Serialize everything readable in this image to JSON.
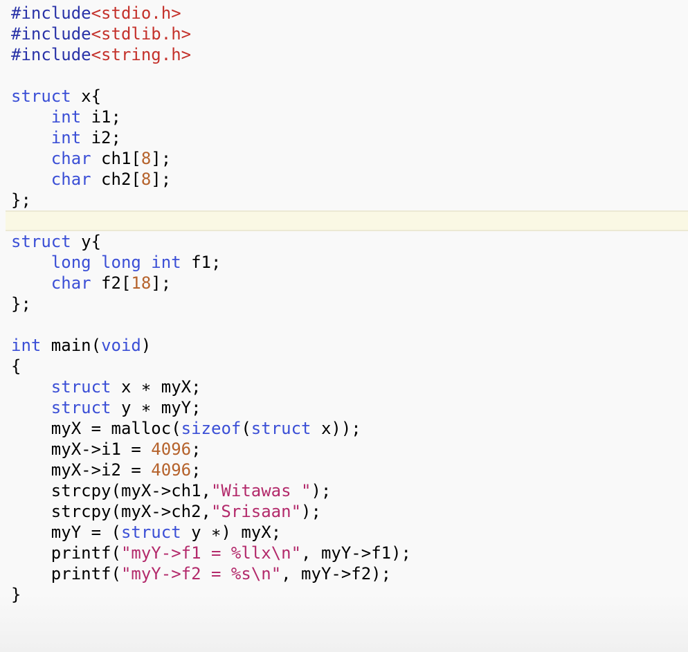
{
  "editor": {
    "language": "c",
    "current_line_index": 10,
    "colors": {
      "background": "#f9f9f9",
      "keyword": "#3b4fd6",
      "preprocessor": "#2a33a8",
      "include_path": "#c4312b",
      "number": "#b5622b",
      "string": "#b32a6b",
      "plain": "#000000",
      "current_line": "#faf8e4"
    },
    "lines": [
      [
        {
          "t": "pp",
          "v": "#include"
        },
        {
          "t": "inc",
          "v": "<stdio.h>"
        }
      ],
      [
        {
          "t": "pp",
          "v": "#include"
        },
        {
          "t": "inc",
          "v": "<stdlib.h>"
        }
      ],
      [
        {
          "t": "pp",
          "v": "#include"
        },
        {
          "t": "inc",
          "v": "<string.h>"
        }
      ],
      [],
      [
        {
          "t": "kw",
          "v": "struct"
        },
        {
          "t": "pl",
          "v": " x{"
        }
      ],
      [
        {
          "t": "pl",
          "v": "    "
        },
        {
          "t": "kw",
          "v": "int"
        },
        {
          "t": "pl",
          "v": " i1;"
        }
      ],
      [
        {
          "t": "pl",
          "v": "    "
        },
        {
          "t": "kw",
          "v": "int"
        },
        {
          "t": "pl",
          "v": " i2;"
        }
      ],
      [
        {
          "t": "pl",
          "v": "    "
        },
        {
          "t": "kw",
          "v": "char"
        },
        {
          "t": "pl",
          "v": " ch1["
        },
        {
          "t": "num",
          "v": "8"
        },
        {
          "t": "pl",
          "v": "];"
        }
      ],
      [
        {
          "t": "pl",
          "v": "    "
        },
        {
          "t": "kw",
          "v": "char"
        },
        {
          "t": "pl",
          "v": " ch2["
        },
        {
          "t": "num",
          "v": "8"
        },
        {
          "t": "pl",
          "v": "];"
        }
      ],
      [
        {
          "t": "pl",
          "v": "};"
        }
      ],
      [],
      [
        {
          "t": "kw",
          "v": "struct"
        },
        {
          "t": "pl",
          "v": " y{"
        }
      ],
      [
        {
          "t": "pl",
          "v": "    "
        },
        {
          "t": "kw",
          "v": "long"
        },
        {
          "t": "pl",
          "v": " "
        },
        {
          "t": "kw",
          "v": "long"
        },
        {
          "t": "pl",
          "v": " "
        },
        {
          "t": "kw",
          "v": "int"
        },
        {
          "t": "pl",
          "v": " f1;"
        }
      ],
      [
        {
          "t": "pl",
          "v": "    "
        },
        {
          "t": "kw",
          "v": "char"
        },
        {
          "t": "pl",
          "v": " f2["
        },
        {
          "t": "num",
          "v": "18"
        },
        {
          "t": "pl",
          "v": "];"
        }
      ],
      [
        {
          "t": "pl",
          "v": "};"
        }
      ],
      [],
      [
        {
          "t": "kw",
          "v": "int"
        },
        {
          "t": "pl",
          "v": " main("
        },
        {
          "t": "kw",
          "v": "void"
        },
        {
          "t": "pl",
          "v": ")"
        }
      ],
      [
        {
          "t": "pl",
          "v": "{"
        }
      ],
      [
        {
          "t": "pl",
          "v": "    "
        },
        {
          "t": "kw",
          "v": "struct"
        },
        {
          "t": "pl",
          "v": " x ∗ myX;"
        }
      ],
      [
        {
          "t": "pl",
          "v": "    "
        },
        {
          "t": "kw",
          "v": "struct"
        },
        {
          "t": "pl",
          "v": " y ∗ myY;"
        }
      ],
      [
        {
          "t": "pl",
          "v": "    myX = malloc("
        },
        {
          "t": "kw",
          "v": "sizeof"
        },
        {
          "t": "pl",
          "v": "("
        },
        {
          "t": "kw",
          "v": "struct"
        },
        {
          "t": "pl",
          "v": " x));"
        }
      ],
      [
        {
          "t": "pl",
          "v": "    myX->i1 = "
        },
        {
          "t": "num",
          "v": "4096"
        },
        {
          "t": "pl",
          "v": ";"
        }
      ],
      [
        {
          "t": "pl",
          "v": "    myX->i2 = "
        },
        {
          "t": "num",
          "v": "4096"
        },
        {
          "t": "pl",
          "v": ";"
        }
      ],
      [
        {
          "t": "pl",
          "v": "    strcpy(myX->ch1,"
        },
        {
          "t": "str",
          "v": "\"Witawas \""
        },
        {
          "t": "pl",
          "v": ");"
        }
      ],
      [
        {
          "t": "pl",
          "v": "    strcpy(myX->ch2,"
        },
        {
          "t": "str",
          "v": "\"Srisaan\""
        },
        {
          "t": "pl",
          "v": ");"
        }
      ],
      [
        {
          "t": "pl",
          "v": "    myY = ("
        },
        {
          "t": "kw",
          "v": "struct"
        },
        {
          "t": "pl",
          "v": " y ∗) myX;"
        }
      ],
      [
        {
          "t": "pl",
          "v": "    printf("
        },
        {
          "t": "str",
          "v": "\"myY->f1 = %llx\\n\""
        },
        {
          "t": "pl",
          "v": ", myY->f1);"
        }
      ],
      [
        {
          "t": "pl",
          "v": "    printf("
        },
        {
          "t": "str",
          "v": "\"myY->f2 = %s\\n\""
        },
        {
          "t": "pl",
          "v": ", myY->f2);"
        }
      ],
      [
        {
          "t": "pl",
          "v": "}"
        }
      ]
    ]
  }
}
